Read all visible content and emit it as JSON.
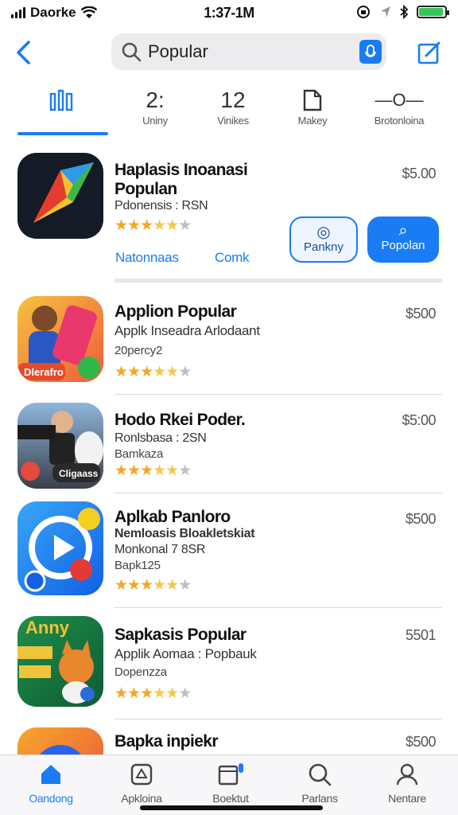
{
  "status": {
    "carrier": "Daorke",
    "time": "1:37-1M",
    "battery_level": 0.95,
    "colors": {
      "battery": "#34c759"
    }
  },
  "search": {
    "value": "Popular",
    "placeholder": "Popular"
  },
  "theme": {
    "accent": "#1a7cf5",
    "star": "#f5a623"
  },
  "tabs": [
    {
      "icon": "chart-icon",
      "glyph": "8̈0",
      "label": ""
    },
    {
      "icon": "number-icon",
      "glyph": "2:",
      "label": "Uniny"
    },
    {
      "icon": "number-icon",
      "glyph": "12",
      "label": "Vinikes"
    },
    {
      "icon": "document-icon",
      "glyph": "",
      "label": "Makey"
    },
    {
      "icon": "toggle-icon",
      "glyph": "—O—",
      "label": "Brotonloina"
    }
  ],
  "featured": {
    "title": "Haplasis Inoanasi",
    "title2": "Populan",
    "subtitle": "Pdonensis : RSN",
    "price": "$5.00",
    "rating": 3.5,
    "link_primary": "Natonnaas",
    "link_secondary": "Comk",
    "btn_outline": "Pankny",
    "btn_fill": "Popolan"
  },
  "apps": [
    {
      "title": "Applion Popular",
      "subtitle": "Applk Inseadra Arlodaant",
      "meta": "20percy2",
      "price": "$500",
      "rating": 3.5,
      "badge": "Dlerafro"
    },
    {
      "title": "Hodo Rkei Poder.",
      "subtitle": "Ronlsbasa : 2SN",
      "meta": "Bamkaza",
      "price": "$5:00",
      "rating": 3.5,
      "badge": "Cligaass"
    },
    {
      "title": "Aplkab Panloro",
      "subtitle": "Nemloasis Bloakletskiat",
      "subtitle2": "Monkonal 7 8SR",
      "meta": "Bapk125",
      "price": "$500",
      "rating": 3.5
    },
    {
      "title": "Sapkasis Popular",
      "subtitle": "Applik Aomaa : Popbauk",
      "meta": "Dopenzza",
      "price": "5501",
      "rating": 3.5,
      "badge": "Anny"
    },
    {
      "title": "Bapka inpiekr",
      "subtitle": "",
      "meta": "",
      "price": "$500"
    }
  ],
  "tabbar": [
    {
      "icon": "home-icon",
      "label": "Oandong",
      "active": true
    },
    {
      "icon": "apps-icon",
      "label": "Apkloina",
      "active": false
    },
    {
      "icon": "calendar-icon",
      "label": "Boektut",
      "active": false
    },
    {
      "icon": "search-icon",
      "label": "Parlans",
      "active": false
    },
    {
      "icon": "profile-icon",
      "label": "Nentare",
      "active": false
    }
  ]
}
